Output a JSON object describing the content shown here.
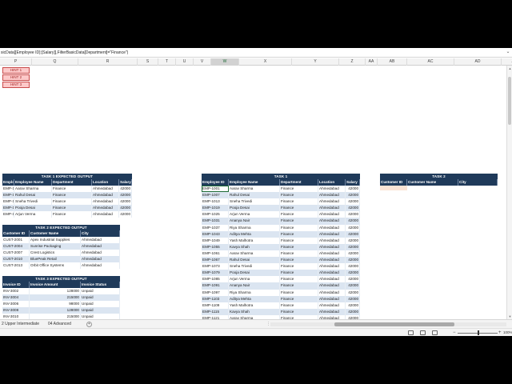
{
  "formula_bar": {
    "text": "sicData[[Employee ID]:[Salary]],FilterBasicData[Department]=\"Finance\")"
  },
  "columns": [
    {
      "label": "P",
      "sel": false
    },
    {
      "label": "Q",
      "sel": false
    },
    {
      "label": "R",
      "sel": false
    },
    {
      "label": "S",
      "sel": false
    },
    {
      "label": "T",
      "sel": false
    },
    {
      "label": "U",
      "sel": false
    },
    {
      "label": "V",
      "sel": false
    },
    {
      "label": "W",
      "sel": true
    },
    {
      "label": "X",
      "sel": false
    },
    {
      "label": "Y",
      "sel": false
    },
    {
      "label": "Z",
      "sel": false
    },
    {
      "label": "AA",
      "sel": false
    },
    {
      "label": "AB",
      "sel": false
    },
    {
      "label": "AC",
      "sel": false
    },
    {
      "label": "AD",
      "sel": false
    },
    {
      "label": "AE",
      "sel": false
    }
  ],
  "hints": [
    "HINT 1",
    "HINT 2",
    "HINT 3"
  ],
  "task1_expected": {
    "title": "TASK 1 EXPECTED OUTPUT",
    "headers": [
      "Employee ID",
      "Employee Name",
      "Department",
      "Location",
      "Salary"
    ],
    "rows": [
      [
        "EMP-1001",
        "Aarav Sharma",
        "Finance",
        "Ahmedabad",
        "42000"
      ],
      [
        "EMP-1007",
        "Rahul Desai",
        "Finance",
        "Ahmedabad",
        "42000"
      ],
      [
        "EMP-1013",
        "Sneha Trivedi",
        "Finance",
        "Ahmedabad",
        "42000"
      ],
      [
        "EMP-1019",
        "Pooja Desai",
        "Finance",
        "Ahmedabad",
        "42000"
      ],
      [
        "EMP-1025",
        "Arjun Verma",
        "Finance",
        "Ahmedabad",
        "42000"
      ]
    ]
  },
  "task2_expected": {
    "title": "TASK 2 EXPECTED OUTPUT",
    "headers": [
      "Customer ID",
      "Customer Name",
      "City"
    ],
    "rows": [
      [
        "CUST-2001",
        "Apex Industrial Supplies",
        "Ahmedabad"
      ],
      [
        "CUST-2004",
        "Sunrise Packaging",
        "Ahmedabad"
      ],
      [
        "CUST-2007",
        "Crest Logistics",
        "Ahmedabad"
      ],
      [
        "CUST-2010",
        "BluePeak Retail",
        "Ahmedabad"
      ],
      [
        "CUST-2013",
        "Orbit Office Systems",
        "Ahmedabad"
      ]
    ]
  },
  "task3_expected": {
    "title": "TASK 3 EXPECTED OUTPUT",
    "headers": [
      "Invoice ID",
      "Invoice Amount",
      "Invoice Status"
    ],
    "rows": [
      [
        "INV-3002",
        "128000",
        "Unpaid"
      ],
      [
        "INV-3004",
        "215000",
        "Unpaid"
      ],
      [
        "INV-3006",
        "98000",
        "Unpaid"
      ],
      [
        "INV-3008",
        "128000",
        "Unpaid"
      ],
      [
        "INV-3010",
        "215000",
        "Unpaid"
      ]
    ]
  },
  "task1": {
    "title": "TASK 1",
    "headers": [
      "Employee ID",
      "Employee Name",
      "Department",
      "Location",
      "Salary"
    ],
    "rows": [
      [
        "EMP-1001",
        "Aarav Sharma",
        "Finance",
        "Ahmedabad",
        "42000"
      ],
      [
        "EMP-1007",
        "Rahul Desai",
        "Finance",
        "Ahmedabad",
        "42000"
      ],
      [
        "EMP-1013",
        "Sneha Trivedi",
        "Finance",
        "Ahmedabad",
        "42000"
      ],
      [
        "EMP-1019",
        "Pooja Desai",
        "Finance",
        "Ahmedabad",
        "42000"
      ],
      [
        "EMP-1025",
        "Arjun Verma",
        "Finance",
        "Ahmedabad",
        "42000"
      ],
      [
        "EMP-1031",
        "Ananya Nair",
        "Finance",
        "Ahmedabad",
        "42000"
      ],
      [
        "EMP-1037",
        "Riya Sharma",
        "Finance",
        "Ahmedabad",
        "42000"
      ],
      [
        "EMP-1043",
        "Aditya Mehta",
        "Finance",
        "Ahmedabad",
        "42000"
      ],
      [
        "EMP-1049",
        "Yash Malhotra",
        "Finance",
        "Ahmedabad",
        "42000"
      ],
      [
        "EMP-1055",
        "Kavya Shah",
        "Finance",
        "Ahmedabad",
        "42000"
      ],
      [
        "EMP-1061",
        "Aarav Sharma",
        "Finance",
        "Ahmedabad",
        "42000"
      ],
      [
        "EMP-1067",
        "Rahul Desai",
        "Finance",
        "Ahmedabad",
        "42000"
      ],
      [
        "EMP-1073",
        "Sneha Trivedi",
        "Finance",
        "Ahmedabad",
        "42000"
      ],
      [
        "EMP-1079",
        "Pooja Desai",
        "Finance",
        "Ahmedabad",
        "42000"
      ],
      [
        "EMP-1085",
        "Arjun Verma",
        "Finance",
        "Ahmedabad",
        "42000"
      ],
      [
        "EMP-1091",
        "Ananya Nair",
        "Finance",
        "Ahmedabad",
        "42000"
      ],
      [
        "EMP-1097",
        "Riya Sharma",
        "Finance",
        "Ahmedabad",
        "42000"
      ],
      [
        "EMP-1103",
        "Aditya Mehta",
        "Finance",
        "Ahmedabad",
        "42000"
      ],
      [
        "EMP-1109",
        "Yash Malhotra",
        "Finance",
        "Ahmedabad",
        "42000"
      ],
      [
        "EMP-1115",
        "Kavya Shah",
        "Finance",
        "Ahmedabad",
        "42000"
      ],
      [
        "EMP-1121",
        "Aarav Sharma",
        "Finance",
        "Ahmedabad",
        "42000"
      ]
    ]
  },
  "task2": {
    "title": "TASK 2",
    "headers": [
      "Customer ID",
      "Customer Name",
      "City"
    ]
  },
  "sheet_tabs": {
    "left": "2 Upper Intermediate",
    "right": "04 Advanced",
    "add": "+",
    "dots": "⋮"
  },
  "zoom": {
    "minus": "−",
    "plus": "+",
    "value": "100%"
  },
  "scroll": {
    "up": "▲",
    "down": "▼"
  }
}
